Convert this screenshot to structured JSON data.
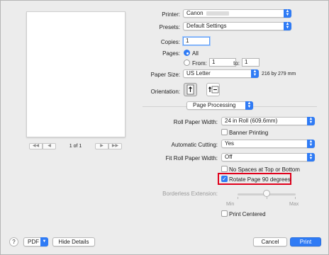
{
  "preview": {
    "page_label": "1 of 1"
  },
  "printer": {
    "label": "Printer:",
    "value": "Canon"
  },
  "presets": {
    "label": "Presets:",
    "value": "Default Settings"
  },
  "copies": {
    "label": "Copies:",
    "value": "1"
  },
  "pages": {
    "label": "Pages:",
    "all_label": "All",
    "from_label": "From:",
    "from_value": "1",
    "to_label": "to:",
    "to_value": "1"
  },
  "paper_size": {
    "label": "Paper Size:",
    "value": "US Letter",
    "dimensions": "216 by 279 mm"
  },
  "orientation": {
    "label": "Orientation:"
  },
  "section": {
    "value": "Page Processing"
  },
  "roll_paper_width": {
    "label": "Roll Paper Width:",
    "value": "24 in Roll (609.6mm)"
  },
  "banner_printing": {
    "label": "Banner Printing"
  },
  "automatic_cutting": {
    "label": "Automatic Cutting:",
    "value": "Yes"
  },
  "fit_roll_paper_width": {
    "label": "Fit Roll Paper Width:",
    "value": "Off"
  },
  "no_spaces": {
    "label": "No Spaces at Top or Bottom"
  },
  "rotate": {
    "label": "Rotate Page 90 degrees"
  },
  "borderless": {
    "label": "Borderless Extension:",
    "min_label": "Min",
    "max_label": "Max"
  },
  "print_centered": {
    "label": "Print Centered"
  },
  "footer": {
    "help": "?",
    "pdf_label": "PDF",
    "hide_details_label": "Hide Details",
    "cancel_label": "Cancel",
    "print_label": "Print"
  },
  "colors": {
    "accent": "#2f7bf5",
    "highlight_box": "#e0001b",
    "dialog_background": "#ececec"
  }
}
